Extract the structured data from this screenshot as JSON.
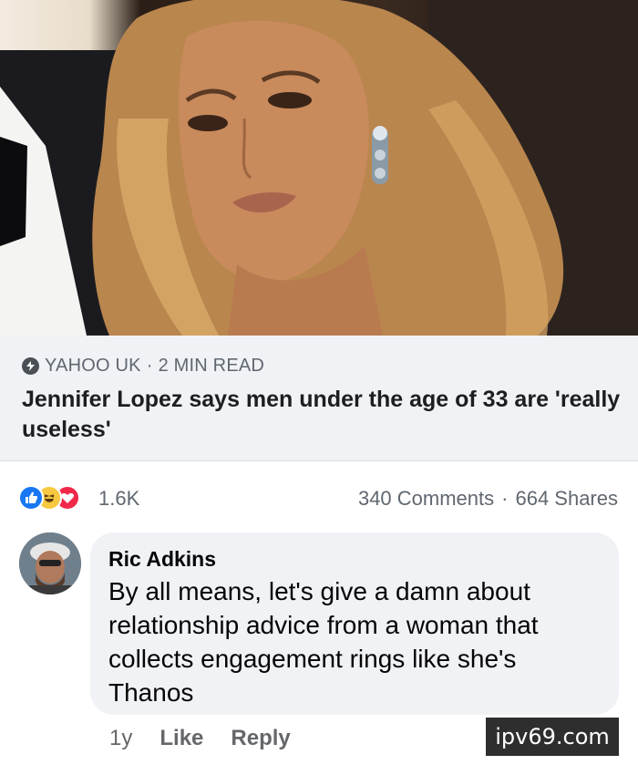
{
  "post": {
    "image_alt": "Photo of Jennifer Lopez",
    "link_preview": {
      "source": "YAHOO UK",
      "separator": "·",
      "read_time": "2 MIN READ",
      "headline": "Jennifer Lopez says men under the age of 33 are 'really useless'"
    },
    "reactions": {
      "icons": [
        "like-icon",
        "haha-icon",
        "love-icon"
      ],
      "count": "1.6K",
      "comments": "340 Comments",
      "separator": "·",
      "shares": "664 Shares",
      "colors": {
        "like": "#1877f2",
        "haha": "#f7c940",
        "love": "#f02849"
      }
    }
  },
  "comment": {
    "author": "Ric Adkins",
    "text": "By all means,  let's give a damn about relationship advice from a woman that collects engagement rings like she's Thanos",
    "time": "1y",
    "like_label": "Like",
    "reply_label": "Reply"
  },
  "watermark": "ipv69.com"
}
